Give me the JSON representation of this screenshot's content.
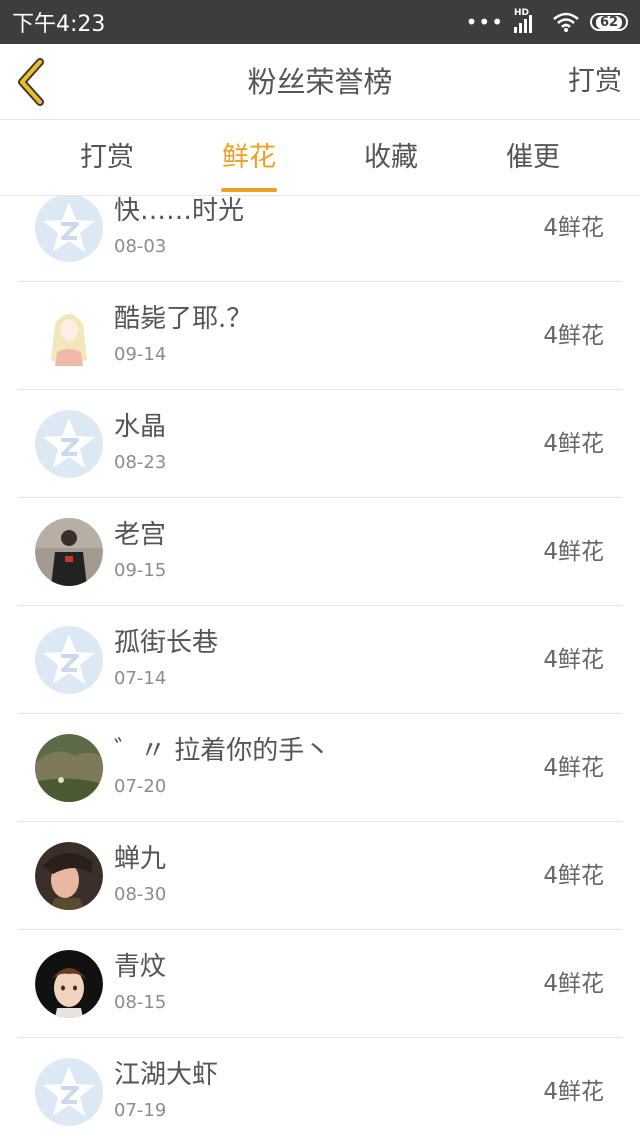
{
  "status_bar": {
    "time": "下午4:23",
    "network_label": "HD",
    "battery": "62"
  },
  "header": {
    "title": "粉丝荣誉榜",
    "action_label": "打赏",
    "back_icon": "chevron-left-icon",
    "accent_color": "#f0c020"
  },
  "tabs": [
    {
      "label": "打赏",
      "active": false
    },
    {
      "label": "鲜花",
      "active": true
    },
    {
      "label": "收藏",
      "active": false
    },
    {
      "label": "催更",
      "active": false
    }
  ],
  "active_color": "#f0a020",
  "rows": [
    {
      "name": "快……时光",
      "date": "08-03",
      "amount": "4鲜花",
      "avatar": "default-star-avatar"
    },
    {
      "name": "酷毙了耶.？",
      "date": "09-14",
      "amount": "4鲜花",
      "avatar": "anime-girl-avatar"
    },
    {
      "name": "水晶",
      "date": "08-23",
      "amount": "4鲜花",
      "avatar": "default-star-avatar"
    },
    {
      "name": "老宫",
      "date": "09-15",
      "amount": "4鲜花",
      "avatar": "photo-man-avatar"
    },
    {
      "name": "孤街长巷",
      "date": "07-14",
      "amount": "4鲜花",
      "avatar": "default-star-avatar"
    },
    {
      "name": "゛〃 拉着你的手丶",
      "date": "07-20",
      "amount": "4鲜花",
      "avatar": "landscape-avatar"
    },
    {
      "name": "蝉九",
      "date": "08-30",
      "amount": "4鲜花",
      "avatar": "young-man-avatar"
    },
    {
      "name": "青炆",
      "date": "08-15",
      "amount": "4鲜花",
      "avatar": "cartoon-boy-avatar"
    },
    {
      "name": "江湖大虾",
      "date": "07-19",
      "amount": "4鲜花",
      "avatar": "default-star-avatar"
    }
  ]
}
